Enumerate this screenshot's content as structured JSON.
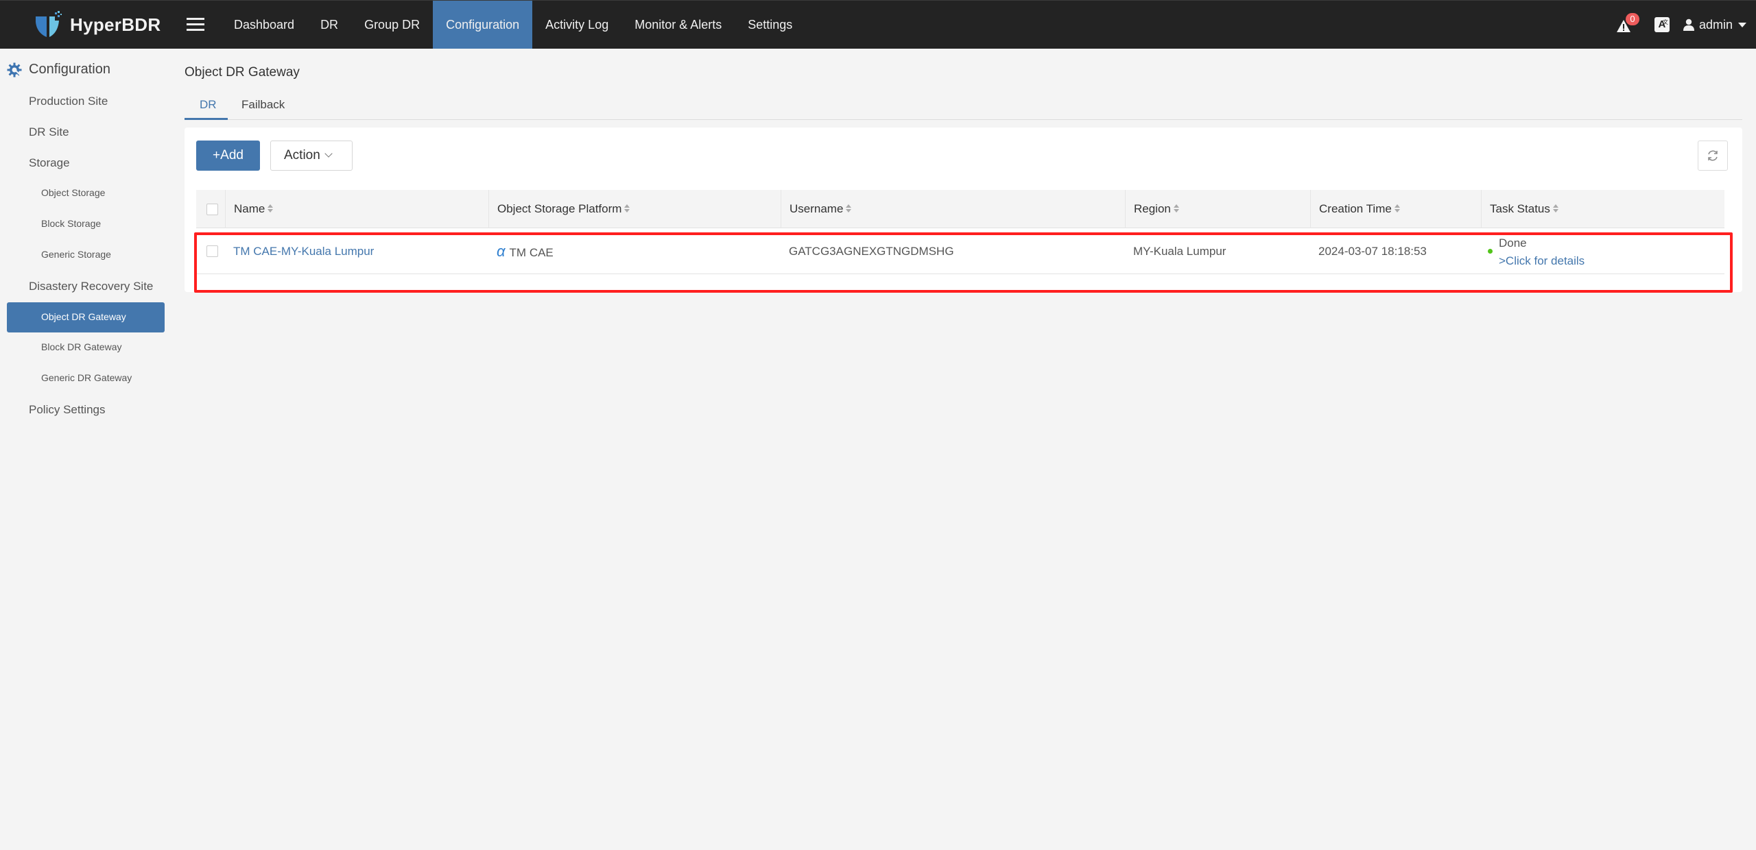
{
  "app": {
    "name": "HyperBDR"
  },
  "topnav": {
    "items": [
      {
        "label": "Dashboard",
        "active": false
      },
      {
        "label": "DR",
        "active": false
      },
      {
        "label": "Group DR",
        "active": false
      },
      {
        "label": "Configuration",
        "active": true
      },
      {
        "label": "Activity Log",
        "active": false
      },
      {
        "label": "Monitor & Alerts",
        "active": false
      },
      {
        "label": "Settings",
        "active": false
      }
    ],
    "alert_count": "0",
    "language_icon_label": "A",
    "user": "admin"
  },
  "sidebar": {
    "header": "Configuration",
    "items": [
      {
        "label": "Production Site",
        "level": 1
      },
      {
        "label": "DR Site",
        "level": 1
      },
      {
        "label": "Storage",
        "level": 1
      },
      {
        "label": "Object Storage",
        "level": 2
      },
      {
        "label": "Block Storage",
        "level": 2
      },
      {
        "label": "Generic Storage",
        "level": 2
      },
      {
        "label": "Disastery Recovery Site",
        "level": 1
      },
      {
        "label": "Object DR Gateway",
        "level": 2,
        "active": true
      },
      {
        "label": "Block DR Gateway",
        "level": 2
      },
      {
        "label": "Generic DR Gateway",
        "level": 2
      },
      {
        "label": "Policy Settings",
        "level": 1
      }
    ]
  },
  "main": {
    "title": "Object DR Gateway",
    "tabs": [
      {
        "label": "DR",
        "active": true
      },
      {
        "label": "Failback",
        "active": false
      }
    ],
    "toolbar": {
      "add_label": "+Add",
      "action_label": "Action"
    },
    "table": {
      "columns": [
        "Name",
        "Object Storage Platform",
        "Username",
        "Region",
        "Creation Time",
        "Task Status"
      ],
      "rows": [
        {
          "name": "TM CAE-MY-Kuala Lumpur",
          "platform_icon": "α",
          "platform": "TM CAE",
          "username": "GATCG3AGNEXGTNGDMSHG",
          "region": "MY-Kuala Lumpur",
          "creation_time": "2024-03-07 18:18:53",
          "status": "Done",
          "status_link": ">Click for details",
          "status_color": "#52c41a"
        }
      ]
    }
  },
  "colors": {
    "accent": "#4477ad",
    "topbar": "#232323",
    "highlight": "#ff1f1f",
    "success": "#52c41a",
    "alert_badge": "#ee5c5c"
  }
}
